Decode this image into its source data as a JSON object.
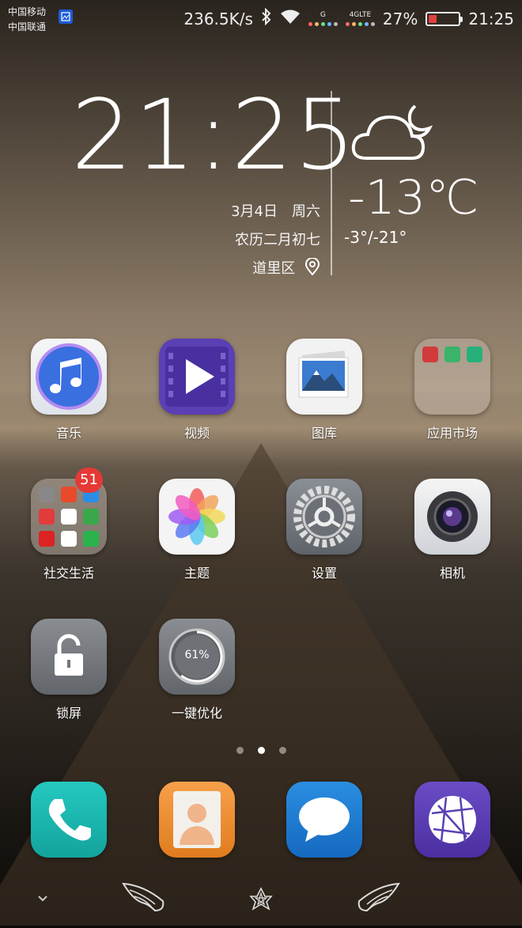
{
  "status_bar": {
    "carrier_1": "中国移动",
    "carrier_2": "中国联通",
    "speed": "236.5K/s",
    "net_1": "G",
    "net_2": "4GLTE",
    "battery": "27%",
    "battery_level": 0.27,
    "time": "21:25"
  },
  "clock_widget": {
    "time": "21:25",
    "date": "3月4日　周六",
    "lunar": "农历二月初七",
    "location": "道里区",
    "temperature": "-13℃",
    "range": "-3°/-21°"
  },
  "apps": [
    {
      "label": "音乐",
      "icon": "music-icon"
    },
    {
      "label": "视频",
      "icon": "video-icon"
    },
    {
      "label": "图库",
      "icon": "gallery-icon"
    },
    {
      "label": "应用市场",
      "icon": "app-market-folder-icon"
    },
    {
      "label": "社交生活",
      "icon": "social-folder-icon",
      "badge": "51"
    },
    {
      "label": "主题",
      "icon": "themes-icon"
    },
    {
      "label": "设置",
      "icon": "settings-gear-icon"
    },
    {
      "label": "相机",
      "icon": "camera-icon"
    },
    {
      "label": "锁屏",
      "icon": "lock-icon"
    },
    {
      "label": "一键优化",
      "icon": "optimize-icon",
      "value": "61%",
      "level": 0.61
    }
  ],
  "dock": [
    {
      "icon": "phone-icon"
    },
    {
      "icon": "contacts-icon"
    },
    {
      "icon": "messages-icon"
    },
    {
      "icon": "browser-icon"
    }
  ],
  "page_indicator": {
    "pages": 3,
    "current": 2
  },
  "nav_bar": [
    {
      "icon": "chevron-down-icon"
    },
    {
      "icon": "back-wing-icon"
    },
    {
      "icon": "home-star-icon"
    },
    {
      "icon": "recents-wing-icon"
    }
  ],
  "colors": {
    "badge": "#e53935",
    "video": "#5b3fb5",
    "phone": "#1fb9b2",
    "contacts": "#f08a2a",
    "messages": "#1e7fd6",
    "browser": "#5b3fb5",
    "battery_low": "#e04040"
  }
}
